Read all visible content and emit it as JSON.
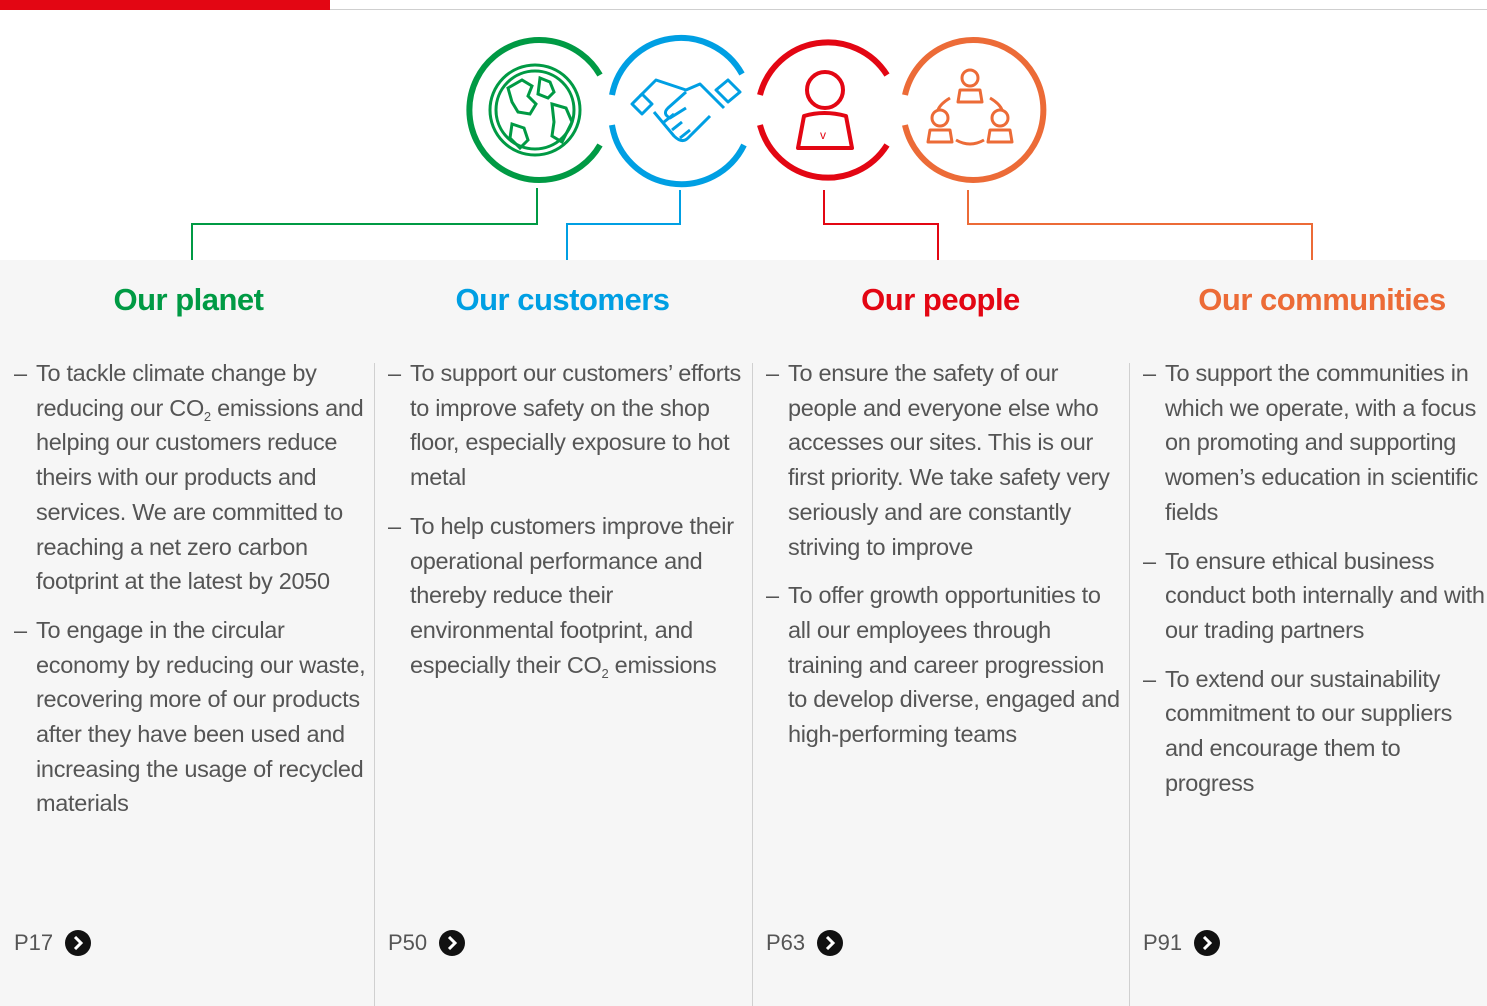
{
  "colors": {
    "planet": "#009a44",
    "customers": "#009fe3",
    "people": "#e30613",
    "communities": "#ec6b37"
  },
  "icons": [
    "globe-icon",
    "handshake-icon",
    "person-laptop-icon",
    "community-network-icon"
  ],
  "columns": [
    {
      "title": "Our planet",
      "items": [
        {
          "before": "To tackle climate change by reducing our CO",
          "sub": "2",
          "after": " emissions and helping our customers reduce theirs with our products and services. We are committed to reaching a net zero carbon footprint at the latest by 2050"
        },
        {
          "before": "To engage in the circular economy by reducing our waste, recovering more of our products after they have been used and increasing the usage of recycled materials",
          "sub": "",
          "after": ""
        }
      ],
      "page": "P17"
    },
    {
      "title": "Our customers",
      "items": [
        {
          "before": "To support our customers’ efforts to improve safety on the shop floor, especially exposure to hot metal",
          "sub": "",
          "after": ""
        },
        {
          "before": "To help customers improve their operational performance and thereby reduce their environmental footprint, and especially their CO",
          "sub": "2",
          "after": " emissions"
        }
      ],
      "page": "P50"
    },
    {
      "title": "Our people",
      "items": [
        {
          "before": "To ensure the safety of our people and everyone else who accesses our sites. This is our first priority. We take safety very seriously and are constantly striving to improve",
          "sub": "",
          "after": ""
        },
        {
          "before": "To offer growth opportunities to all our employees through training and career progression to develop diverse, engaged and high-performing teams",
          "sub": "",
          "after": ""
        }
      ],
      "page": "P63"
    },
    {
      "title": "Our communities",
      "items": [
        {
          "before": "To support the communities in which we operate, with a focus on promoting and supporting women’s education in scientific fields",
          "sub": "",
          "after": ""
        },
        {
          "before": "To ensure ethical business conduct both internally and with our trading partners",
          "sub": "",
          "after": ""
        },
        {
          "before": "To extend our sustainability commitment to our suppliers and encourage them to progress",
          "sub": "",
          "after": ""
        }
      ],
      "page": "P91"
    }
  ]
}
